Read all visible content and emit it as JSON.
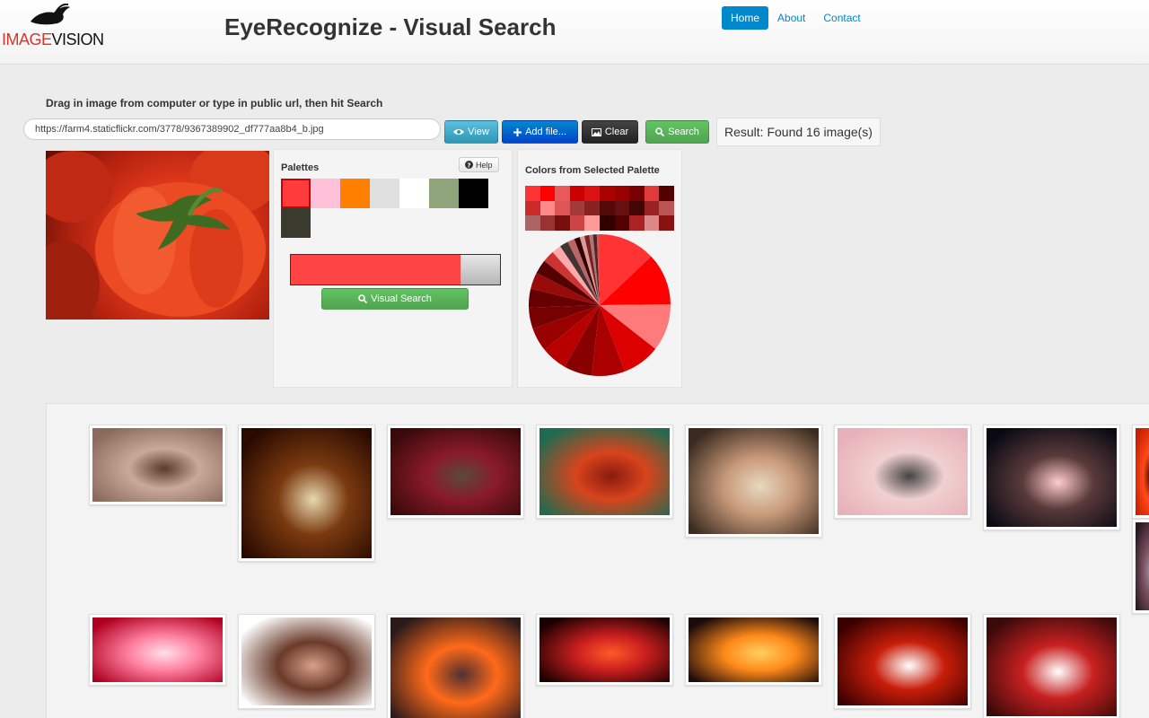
{
  "header": {
    "logo_text_image": "IMAGE",
    "logo_text_vision": "VISION",
    "site_title": "EyeRecognize - Visual Search",
    "nav": [
      {
        "label": "Home",
        "active": true
      },
      {
        "label": "About",
        "active": false
      },
      {
        "label": "Contact",
        "active": false
      }
    ]
  },
  "search": {
    "instruction": "Drag in image from computer or type in public url, then hit Search",
    "url_value": "https://farm4.staticflickr.com/3778/9367389902_df777aa8b4_b.jpg",
    "view_label": "View",
    "add_file_label": "Add file...",
    "clear_label": "Clear",
    "search_label": "Search",
    "result_text": "Result: Found 16 image(s)"
  },
  "palettes": {
    "title": "Palettes",
    "help_label": "Help",
    "swatches": [
      "#ff3b3b",
      "#ffc0d8",
      "#ff8000",
      "#e0e0e0",
      "#ffffff",
      "#8fa47a",
      "#000000",
      "#3a3a2e"
    ],
    "selected_index": 0,
    "bar_colors": [
      "#ff4444",
      "#b5b5b5"
    ],
    "bar_split": 0.81,
    "visual_search_label": "Visual Search"
  },
  "colors_panel": {
    "title": "Colors from Selected Palette",
    "grid": [
      "#ff3333",
      "#ff0000",
      "#e85a5a",
      "#cc0000",
      "#dd1111",
      "#aa0000",
      "#990000",
      "#770000",
      "#e03a3a",
      "#550000",
      "#cc2a2a",
      "#ff8888",
      "#dd5555",
      "#a33a3a",
      "#882222",
      "#550a0a",
      "#661111",
      "#440505",
      "#992222",
      "#bb5555",
      "#aa6666",
      "#993333",
      "#770f0f",
      "#cc4444",
      "#ff9999",
      "#330000",
      "#550000",
      "#aa2222",
      "#dd8888",
      "#881111"
    ],
    "pie": [
      {
        "color": "#ff3333",
        "value": 12
      },
      {
        "color": "#ff0000",
        "value": 11
      },
      {
        "color": "#ff7a7a",
        "value": 10
      },
      {
        "color": "#dd0000",
        "value": 8
      },
      {
        "color": "#aa0000",
        "value": 7
      },
      {
        "color": "#880000",
        "value": 6
      },
      {
        "color": "#b80000",
        "value": 5.5
      },
      {
        "color": "#990000",
        "value": 5
      },
      {
        "color": "#770000",
        "value": 4.5
      },
      {
        "color": "#660000",
        "value": 4
      },
      {
        "color": "#990a0a",
        "value": 3.5
      },
      {
        "color": "#550000",
        "value": 3
      },
      {
        "color": "#cc3333",
        "value": 2.5
      },
      {
        "color": "#ffaaaa",
        "value": 2
      },
      {
        "color": "#443333",
        "value": 1.8
      },
      {
        "color": "#bb6666",
        "value": 1.5
      },
      {
        "color": "#330000",
        "value": 1.2
      },
      {
        "color": "#dd9999",
        "value": 1
      },
      {
        "color": "#772222",
        "value": 1
      },
      {
        "color": "#aa7777",
        "value": 0.8
      },
      {
        "color": "#552222",
        "value": 0.8
      },
      {
        "color": "#cc5555",
        "value": 0.6
      }
    ]
  },
  "results": [
    {
      "name": "result-bubbles",
      "colors": [
        "#8a6a5a",
        "#c9a99a",
        "#5a3a2a"
      ]
    },
    {
      "name": "result-calla-lily",
      "colors": [
        "#2a0a00",
        "#7a3a10",
        "#e8d8b0"
      ]
    },
    {
      "name": "result-flower-vase",
      "colors": [
        "#3a0a0a",
        "#8a1a2a",
        "#5a4a3a"
      ]
    },
    {
      "name": "result-lily",
      "colors": [
        "#1f6b4f",
        "#d8441c",
        "#8a1a10"
      ]
    },
    {
      "name": "result-three-people",
      "colors": [
        "#3a2a20",
        "#c89a7a",
        "#e8d8c0"
      ]
    },
    {
      "name": "result-toy-houses",
      "colors": [
        "#e8b0b8",
        "#f0d0d0",
        "#444444"
      ]
    },
    {
      "name": "result-city-night",
      "colors": [
        "#0a0a14",
        "#5a3a3a",
        "#ffcccc"
      ]
    },
    {
      "name": "result-leaf-grasshopper",
      "colors": [
        "#c81e00",
        "#ff4a1a",
        "#4a0a00"
      ]
    },
    {
      "name": "result-petals",
      "colors": [
        "#b00020",
        "#ff80a0",
        "#ffe0e8"
      ]
    },
    {
      "name": "result-portrait",
      "colors": [
        "#ffffff",
        "#6a3a2a",
        "#d8a088"
      ]
    },
    {
      "name": "result-sunset-sea",
      "colors": [
        "#2a1a1a",
        "#ff6a1a",
        "#503030"
      ]
    },
    {
      "name": "result-red-sky",
      "colors": [
        "#1a0000",
        "#c81e1e",
        "#ff5a2a"
      ]
    },
    {
      "name": "result-silhouette-sunset",
      "colors": [
        "#1a0a0a",
        "#ff8a1a",
        "#ffd060"
      ]
    },
    {
      "name": "result-hearts-street",
      "colors": [
        "#3a0000",
        "#c81e0a",
        "#ffffff"
      ]
    },
    {
      "name": "result-edge-1",
      "colors": [
        "#3a0a0a",
        "#c82020",
        "#ffffff"
      ]
    },
    {
      "name": "result-edge-2",
      "colors": [
        "#2a1a20",
        "#7a5060",
        "#a090a0"
      ]
    }
  ]
}
